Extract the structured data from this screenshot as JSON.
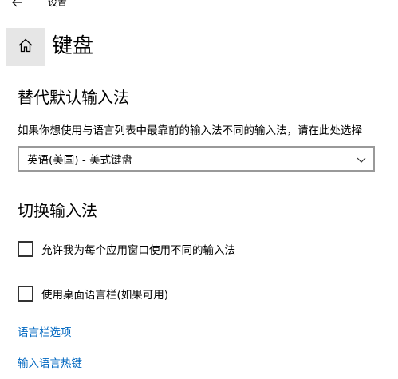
{
  "window": {
    "title": "设置"
  },
  "header": {
    "title": "键盘"
  },
  "override": {
    "heading": "替代默认输入法",
    "description": "如果你想使用与语言列表中最靠前的输入法不同的输入法，请在此处选择",
    "selected_value": "英语(美国) - 美式键盘"
  },
  "switching": {
    "heading": "切换输入法",
    "options": [
      {
        "label": "允许我为每个应用窗口使用不同的输入法",
        "checked": false
      },
      {
        "label": "使用桌面语言栏(如果可用)",
        "checked": false
      }
    ]
  },
  "links": {
    "language_bar_options": "语言栏选项",
    "input_language_hotkeys": "输入语言热键"
  },
  "colors": {
    "link": "#0067c0",
    "home_bg": "#e6e6e6"
  },
  "icons": {
    "back": "back-arrow-icon",
    "home": "home-icon",
    "dropdown": "chevron-down-icon"
  }
}
